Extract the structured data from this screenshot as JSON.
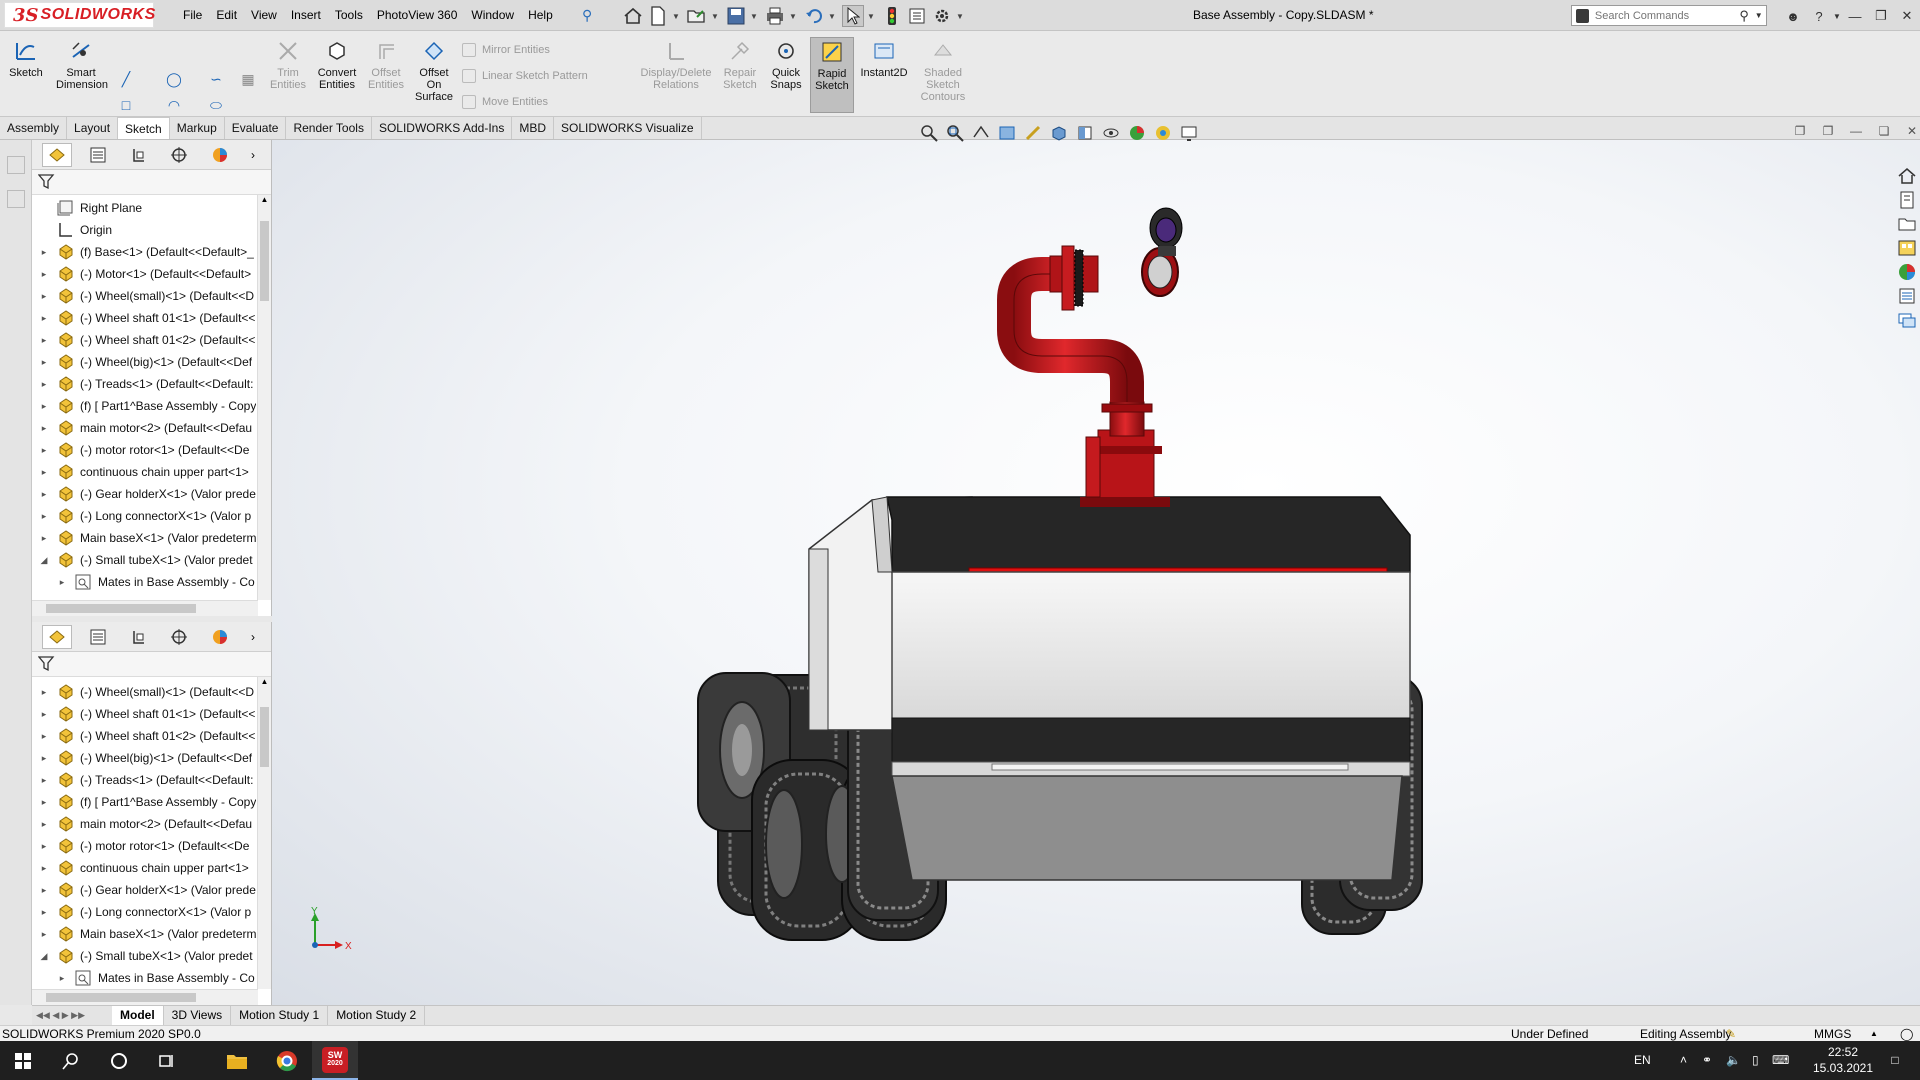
{
  "app": {
    "logo_mark": "3S",
    "logo_text": "SOLIDWORKS",
    "document_title": "Base Assembly - Copy.SLDASM *"
  },
  "menu": [
    "File",
    "Edit",
    "View",
    "Insert",
    "Tools",
    "PhotoView 360",
    "Window",
    "Help"
  ],
  "search": {
    "placeholder": "Search Commands"
  },
  "ribbon": {
    "sketch": "Sketch",
    "smart_dimension_1": "Smart",
    "smart_dimension_2": "Dimension",
    "trim_1": "Trim",
    "trim_2": "Entities",
    "convert_1": "Convert",
    "convert_2": "Entities",
    "offset_1": "Offset",
    "offset_2": "Entities",
    "offset_surface_1": "Offset",
    "offset_surface_2": "On",
    "offset_surface_3": "Surface",
    "mirror": "Mirror Entities",
    "linear_pattern": "Linear Sketch Pattern",
    "move": "Move Entities",
    "display_delete_1": "Display/Delete",
    "display_delete_2": "Relations",
    "repair_1": "Repair",
    "repair_2": "Sketch",
    "quick_snaps_1": "Quick",
    "quick_snaps_2": "Snaps",
    "rapid_sketch_1": "Rapid",
    "rapid_sketch_2": "Sketch",
    "instant2d": "Instant2D",
    "shaded_1": "Shaded",
    "shaded_2": "Sketch",
    "shaded_3": "Contours"
  },
  "tabs": [
    "Assembly",
    "Layout",
    "Sketch",
    "Markup",
    "Evaluate",
    "Render Tools",
    "SOLIDWORKS Add-Ins",
    "MBD",
    "SOLIDWORKS Visualize"
  ],
  "active_tab": "Sketch",
  "tree_top": [
    {
      "label": "Right Plane",
      "type": "plane"
    },
    {
      "label": "Origin",
      "type": "origin"
    },
    {
      "label": "(f) Base<1> (Default<<Default>_",
      "type": "comp"
    },
    {
      "label": "(-) Motor<1> (Default<<Default>",
      "type": "comp"
    },
    {
      "label": "(-) Wheel(small)<1> (Default<<D",
      "type": "comp"
    },
    {
      "label": "(-) Wheel shaft 01<1> (Default<<",
      "type": "comp"
    },
    {
      "label": "(-) Wheel shaft 01<2> (Default<<",
      "type": "comp"
    },
    {
      "label": "(-) Wheel(big)<1> (Default<<Def",
      "type": "comp"
    },
    {
      "label": "(-) Treads<1> (Default<<Default:",
      "type": "comp"
    },
    {
      "label": "(f) [ Part1^Base Assembly - Copy",
      "type": "comp"
    },
    {
      "label": "main motor<2> (Default<<Defau",
      "type": "comp"
    },
    {
      "label": "(-) motor rotor<1> (Default<<De",
      "type": "comp"
    },
    {
      "label": "continuous chain upper part<1>",
      "type": "comp"
    },
    {
      "label": "(-) Gear holderX<1> (Valor prede",
      "type": "comp"
    },
    {
      "label": "(-) Long connectorX<1> (Valor p",
      "type": "comp"
    },
    {
      "label": "Main baseX<1> (Valor predeterm",
      "type": "comp"
    },
    {
      "label": "(-) Small tubeX<1> (Valor predet",
      "type": "comp"
    },
    {
      "label": "Mates in Base Assembly - Co",
      "type": "mates"
    }
  ],
  "tree_bottom": [
    {
      "label": "(-) Wheel(small)<1> (Default<<D",
      "type": "comp"
    },
    {
      "label": "(-) Wheel shaft 01<1> (Default<<",
      "type": "comp"
    },
    {
      "label": "(-) Wheel shaft 01<2> (Default<<",
      "type": "comp"
    },
    {
      "label": "(-) Wheel(big)<1> (Default<<Def",
      "type": "comp"
    },
    {
      "label": "(-) Treads<1> (Default<<Default:",
      "type": "comp"
    },
    {
      "label": "(f) [ Part1^Base Assembly - Copy",
      "type": "comp"
    },
    {
      "label": "main motor<2> (Default<<Defau",
      "type": "comp"
    },
    {
      "label": "(-) motor rotor<1> (Default<<De",
      "type": "comp"
    },
    {
      "label": "continuous chain upper part<1>",
      "type": "comp"
    },
    {
      "label": "(-) Gear holderX<1> (Valor prede",
      "type": "comp"
    },
    {
      "label": "(-) Long connectorX<1> (Valor p",
      "type": "comp"
    },
    {
      "label": "Main baseX<1> (Valor predeterm",
      "type": "comp"
    },
    {
      "label": "(-) Small tubeX<1> (Valor predet",
      "type": "comp"
    },
    {
      "label": "Mates in Base Assembly - Co",
      "type": "mates"
    }
  ],
  "triad": {
    "y": "Y",
    "x": "X"
  },
  "bottom_tabs": [
    "Model",
    "3D Views",
    "Motion Study 1",
    "Motion Study 2"
  ],
  "active_bottom_tab": "Model",
  "status": {
    "product": "SOLIDWORKS Premium 2020 SP0.0",
    "state": "Under Defined",
    "mode": "Editing Assembly",
    "units": "MMGS"
  },
  "taskbar": {
    "language": "EN",
    "time": "22:52",
    "date": "15.03.2021",
    "sw_badge": "2020"
  },
  "colors": {
    "solidworks_red": "#d81e24",
    "cannon_red": "#c8141a",
    "accent_blue": "#1b64b5"
  }
}
